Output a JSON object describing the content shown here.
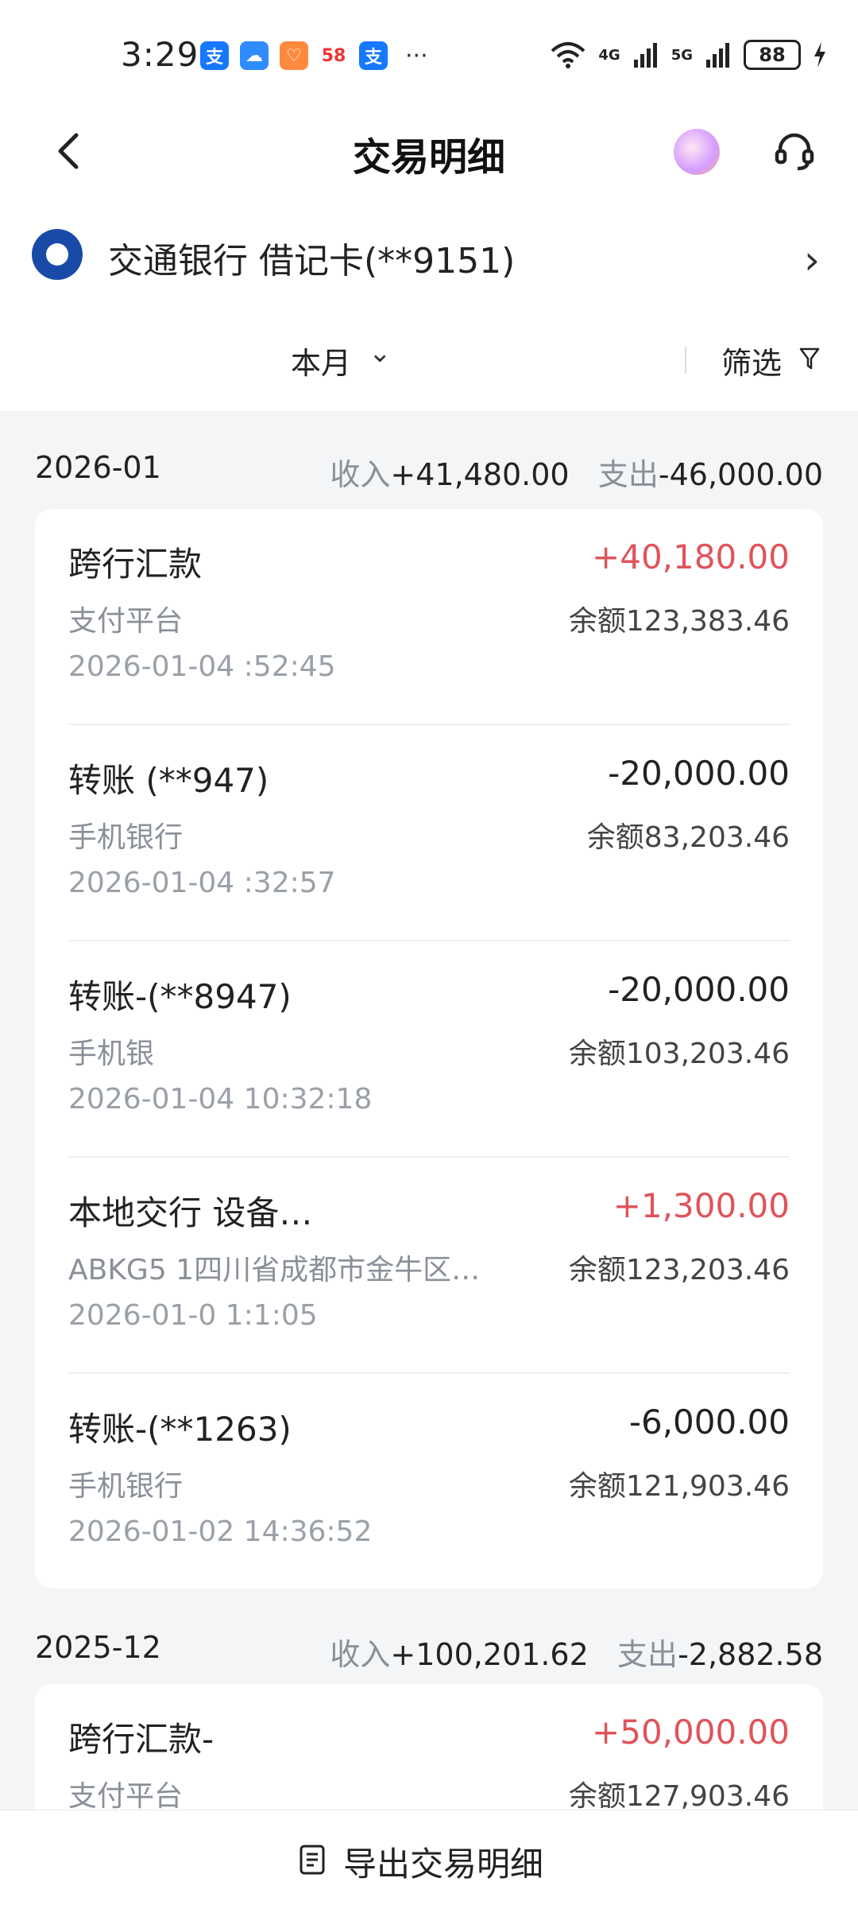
{
  "status_bar": {
    "time": "3:29",
    "apps": [
      "支",
      "",
      "",
      "58",
      "支"
    ],
    "more": "···",
    "net1": "4G",
    "net2": "5G",
    "battery": "88"
  },
  "nav": {
    "title": "交易明细"
  },
  "account": {
    "name": "交通银行 借记卡(**9151)"
  },
  "filter": {
    "period": "本月",
    "filter_label": "筛选"
  },
  "groups": [
    {
      "date": "2026-01",
      "income_label": "收入",
      "income": "+41,480.00",
      "expense_label": "支出",
      "expense": "-46,000.00",
      "transactions": [
        {
          "title": "跨行汇款",
          "amount": "+40,180.00",
          "direction": "in",
          "sub": "支付平台",
          "balance": "余额123,383.46",
          "time": "2026-01-04 :52:45"
        },
        {
          "title": "转账 (**947)",
          "amount": "-20,000.00",
          "direction": "out",
          "sub": "手机银行",
          "balance": "余额83,203.46",
          "time": "2026-01-04 :32:57"
        },
        {
          "title": "转账-(**8947)",
          "amount": "-20,000.00",
          "direction": "out",
          "sub": "手机银",
          "balance": "余额103,203.46",
          "time": "2026-01-04 10:32:18"
        },
        {
          "title": "本地交行 设备…",
          "amount": "+1,300.00",
          "direction": "in",
          "sub": "ABKG5 1四川省成都市金牛区…",
          "balance": "余额123,203.46",
          "time": "2026-01-0 1:1:05"
        },
        {
          "title": "转账-(**1263)",
          "amount": "-6,000.00",
          "direction": "out",
          "sub": "手机银行",
          "balance": "余额121,903.46",
          "time": "2026-01-02 14:36:52"
        }
      ]
    },
    {
      "date": "2025-12",
      "income_label": "收入",
      "income": "+100,201.62",
      "expense_label": "支出",
      "expense": "-2,882.58",
      "transactions": [
        {
          "title": "跨行汇款-",
          "amount": "+50,000.00",
          "direction": "in",
          "sub": "支付平台",
          "balance": "余额127,903.46",
          "time": ""
        }
      ]
    }
  ],
  "export": {
    "label": "导出交易明细"
  },
  "colors": {
    "income_amount": "#e0535a",
    "expense_amount": "#222222",
    "background": "#f4f5f7",
    "bank_logo": "#1a4aa8"
  }
}
